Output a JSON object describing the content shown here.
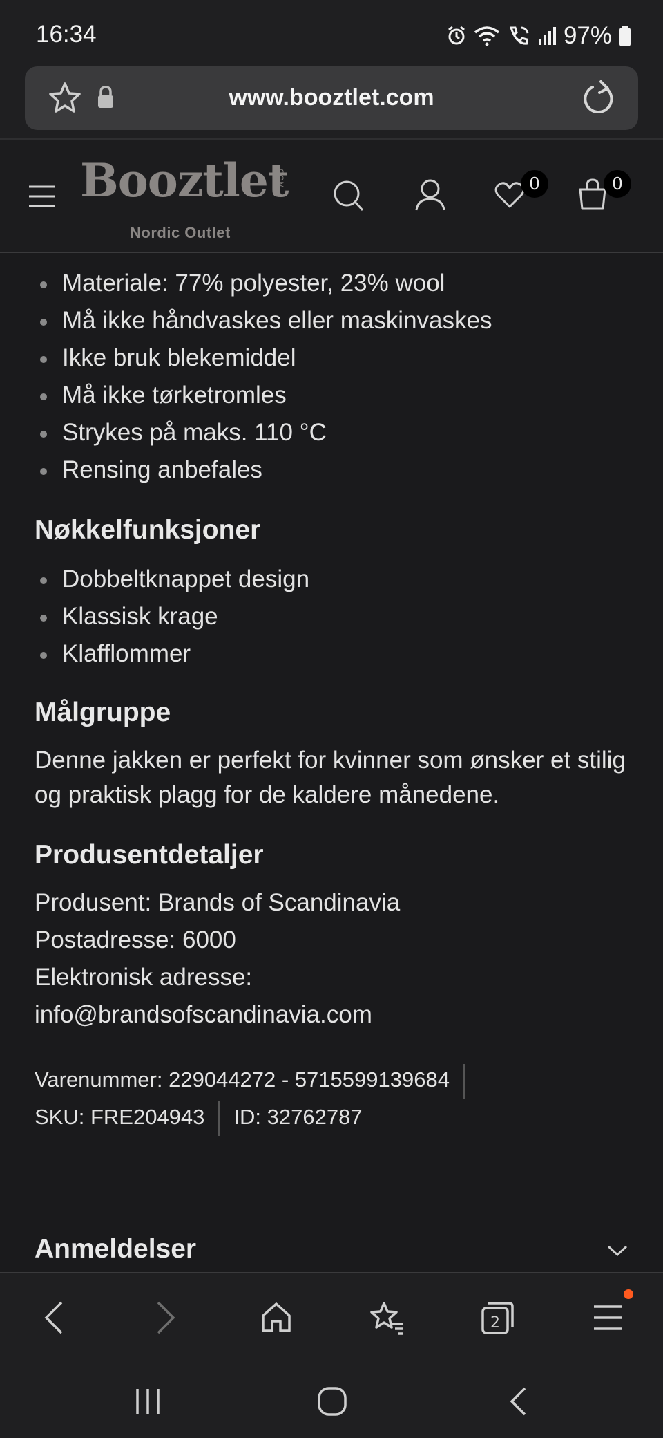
{
  "status_bar": {
    "time": "16:34",
    "battery": "97%",
    "icons": [
      "alarm-icon",
      "wifi-icon",
      "wifi-call-icon",
      "signal-icon",
      "battery-icon"
    ]
  },
  "browser": {
    "url": "www.booztlet.com",
    "icons": [
      "star-icon",
      "lock-icon",
      "reload-icon"
    ]
  },
  "site_header": {
    "logo_text": "Booztlet",
    "logo_com": ".COM",
    "logo_subtitle": "Nordic Outlet",
    "wishlist_count": "0",
    "cart_count": "0",
    "icons": [
      "menu-icon",
      "search-icon",
      "account-icon",
      "heart-icon",
      "bag-icon"
    ]
  },
  "product": {
    "care_list": [
      "Materiale: 77% polyester, 23% wool",
      "Må ikke håndvaskes eller maskinvaskes",
      "Ikke bruk blekemiddel",
      "Må ikke tørketromles",
      "Strykes på maks. 110 °C",
      "Rensing anbefales"
    ],
    "features_heading": "Nøkkelfunksjoner",
    "features_list": [
      "Dobbeltknappet design",
      "Klassisk krage",
      "Klafflommer"
    ],
    "audience_heading": "Målgruppe",
    "audience_text": "Denne jakken er perfekt for kvinner som ønsker et stilig og praktisk plagg for de kaldere månedene.",
    "manufacturer_heading": "Produsentdetaljer",
    "manufacturer_lines": [
      "Produsent: Brands of Scandinavia",
      "Postadresse: 6000",
      "Elektronisk adresse:",
      "info@brandsofscandinavia.com"
    ],
    "item_number": "Varenummer: 229044272 - 5715599139684",
    "sku": "SKU: FRE204943",
    "id": "ID: 32762787",
    "reviews_heading": "Anmeldelser"
  },
  "browser_toolbar": {
    "tab_count": "2",
    "icons": [
      "back-icon",
      "forward-icon",
      "home-icon",
      "bookmarks-icon",
      "tabs-icon",
      "menu-icon"
    ],
    "accent_color": "#ff5a1f"
  },
  "nav_bar": {
    "icons": [
      "recents-icon",
      "home-icon",
      "back-icon"
    ]
  }
}
